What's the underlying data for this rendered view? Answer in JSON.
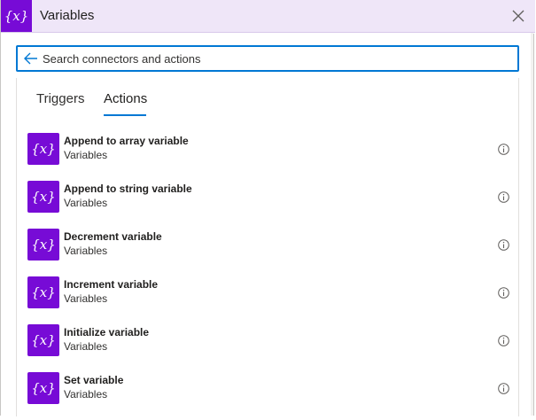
{
  "header": {
    "icon_text": "{x}",
    "title": "Variables",
    "close_icon": "close-icon"
  },
  "search": {
    "placeholder": "Search connectors and actions",
    "value": "",
    "back_icon": "arrow-left-icon"
  },
  "tabs": [
    {
      "label": "Triggers",
      "selected": false
    },
    {
      "label": "Actions",
      "selected": true
    }
  ],
  "actions": [
    {
      "icon_text": "{x}",
      "title": "Append to array variable",
      "connector": "Variables"
    },
    {
      "icon_text": "{x}",
      "title": "Append to string variable",
      "connector": "Variables"
    },
    {
      "icon_text": "{x}",
      "title": "Decrement variable",
      "connector": "Variables"
    },
    {
      "icon_text": "{x}",
      "title": "Increment variable",
      "connector": "Variables"
    },
    {
      "icon_text": "{x}",
      "title": "Initialize variable",
      "connector": "Variables"
    },
    {
      "icon_text": "{x}",
      "title": "Set variable",
      "connector": "Variables"
    }
  ],
  "colors": {
    "brand": "#770bd6",
    "header_bg": "#efe6f8",
    "accent": "#0078d4"
  }
}
